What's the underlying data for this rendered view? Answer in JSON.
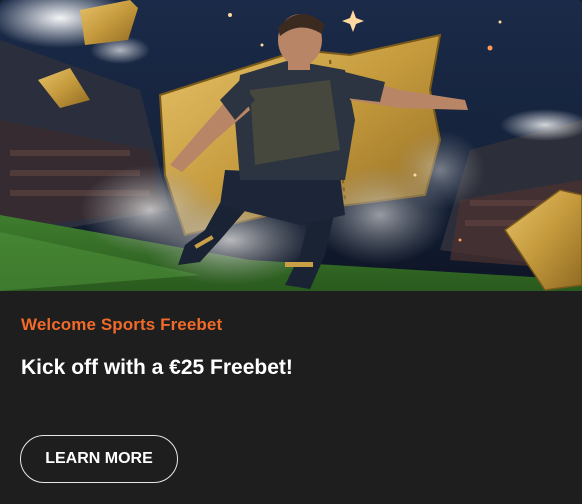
{
  "promo": {
    "eyebrow": "Welcome Sports Freebet",
    "headline": "Kick off with a €25 Freebet!",
    "cta_label": "LEARN MORE"
  },
  "colors": {
    "accent": "#f06a2a",
    "card_background": "#1e1e1e",
    "text": "#ffffff",
    "button_border": "#e8e8e8",
    "ticket_gold": "#c9a046"
  },
  "hero": {
    "subject": "footballer kicking ball in stadium with golden tickets",
    "icons": [
      "golden-ticket-icon",
      "sparkle-icon"
    ]
  }
}
